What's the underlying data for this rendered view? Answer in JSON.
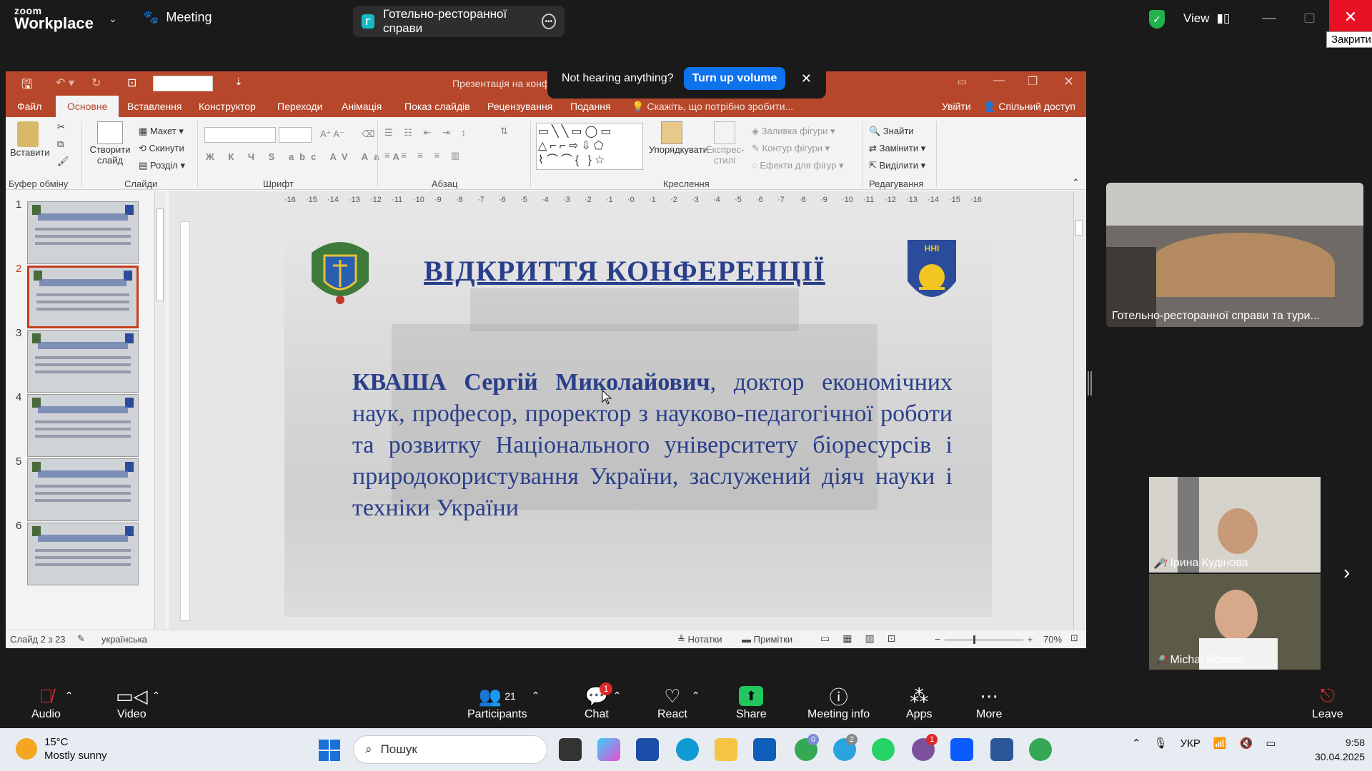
{
  "zoom": {
    "logo_top": "zoom",
    "logo_bottom": "Workplace",
    "meeting_label": "Meeting",
    "share_title": "Готельно-ресторанної справи",
    "share_initial": "Г",
    "view_label": "View",
    "close_tooltip": "Закрити"
  },
  "notice": {
    "text": "Not hearing anything?",
    "button": "Turn up volume"
  },
  "ppt": {
    "title": "Презентація на конфе...",
    "tabs": [
      "Файл",
      "Основне",
      "Вставлення",
      "Конструктор",
      "Переходи",
      "Анімація",
      "Показ слайдів",
      "Рецензування",
      "Подання"
    ],
    "tell_me": "Скажіть, що потрібно зробити...",
    "sign_in": "Увійти",
    "share": "Спільний доступ",
    "ribbon": {
      "paste": "Вставити",
      "new_slide": "Створити слайд",
      "layout": "Макет",
      "reset": "Скинути",
      "section": "Розділ",
      "arrange": "Упорядкувати",
      "quick_styles": "Експрес-стилі",
      "shape_fill": "Заливка фігури",
      "shape_outline": "Контур фігури",
      "shape_effects": "Ефекти для фігур",
      "find": "Знайти",
      "replace": "Замінити",
      "select": "Виділити",
      "groups": [
        "Буфер обміну",
        "Слайди",
        "Шрифт",
        "Абзац",
        "Креслення",
        "Редагування"
      ]
    },
    "ruler_numbers": [
      "16",
      "15",
      "14",
      "13",
      "12",
      "11",
      "10",
      "9",
      "8",
      "7",
      "6",
      "5",
      "4",
      "3",
      "2",
      "1",
      "0",
      "1",
      "2",
      "3",
      "4",
      "5",
      "6",
      "7",
      "8",
      "9",
      "10",
      "11",
      "12",
      "13",
      "14",
      "15",
      "16"
    ],
    "slide": {
      "title": "ВІДКРИТТЯ КОНФЕРЕНЦІЇ",
      "name": "КВАША Сергій Миколайович",
      "body": ", доктор економічних наук, професор, проректор з науково-педагогічної роботи та розвитку Національного університету біоресурсів і природокористування України, заслужений діяч науки і техніки України",
      "right_logo_text": "ННІ"
    },
    "thumbnails": [
      "1",
      "2",
      "3",
      "4",
      "5",
      "6"
    ],
    "status": {
      "slide_counter": "Слайд 2 з 23",
      "language": "українська",
      "notes": "Нотатки",
      "comments": "Примітки",
      "zoom": "70%"
    }
  },
  "videos": {
    "main_label": "Готельно-ресторанної справи та тури...",
    "p1": "Ірина Кудінова",
    "p2": "Michał Roman"
  },
  "toolbar": {
    "audio": "Audio",
    "video": "Video",
    "participants": "Participants",
    "participants_count": "21",
    "chat": "Chat",
    "chat_badge": "1",
    "react": "React",
    "share": "Share",
    "meeting_info": "Meeting info",
    "apps": "Apps",
    "more": "More",
    "leave": "Leave"
  },
  "taskbar": {
    "temp": "15°C",
    "weather": "Mostly sunny",
    "search": "Пошук",
    "lang": "УКР",
    "time": "9:58",
    "date": "30.04.2025",
    "badge_chrome": "0",
    "badge_telegram": "2",
    "badge_viber": "1"
  }
}
